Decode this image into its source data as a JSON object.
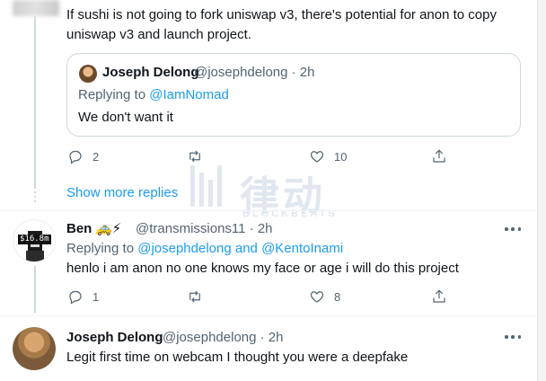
{
  "top_tweet": {
    "text_line1": "If sushi is not going to fork uniswap v3, there's potential for anon to copy",
    "text_line2": "uniswap v3 and launch project."
  },
  "quote": {
    "name": "Joseph Delong",
    "handle": "@josephdelong · 2h",
    "replying_prefix": "Replying to ",
    "replying_to": "@IamNomad",
    "body": "We don't want it"
  },
  "top_actions": {
    "reply_count": "2",
    "retweet_count": "",
    "like_count": "10"
  },
  "show_more_replies": "Show more replies",
  "watermark": {
    "cn": "律动",
    "en": "BLOCKBEATS"
  },
  "ben": {
    "name": "Ben",
    "emoji": "🚕⚡",
    "handle": "@transmissions11 · 2h",
    "avatar_tag": "$16.8m",
    "replying_prefix": "Replying to ",
    "replying_to_1": "@josephdelong",
    "replying_and": " and ",
    "replying_to_2": "@KentoInami",
    "body": "henlo i am anon no one knows my face or age i will do this project",
    "reply_count": "1",
    "like_count": "8"
  },
  "jd": {
    "name": "Joseph Delong",
    "handle": "@josephdelong · 2h",
    "body": "Legit first time on webcam I thought you were a deepfake"
  },
  "icons": {
    "reply": "reply-icon",
    "retweet": "retweet-icon",
    "like": "heart-icon",
    "share": "share-icon",
    "more": "more-icon"
  },
  "colors": {
    "link": "#1d9bf0",
    "muted": "#536471",
    "text": "#0f1419",
    "border": "#cfd9de"
  }
}
